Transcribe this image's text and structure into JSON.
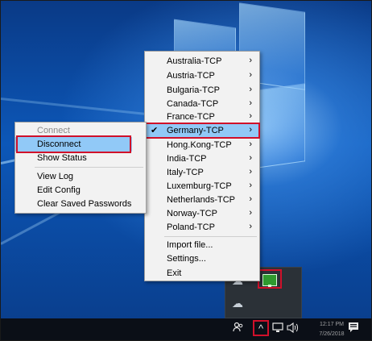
{
  "servers_menu": {
    "items": [
      {
        "label": "Australia-TCP",
        "arrow": "›"
      },
      {
        "label": "Austria-TCP",
        "arrow": "›"
      },
      {
        "label": "Bulgaria-TCP",
        "arrow": "›"
      },
      {
        "label": "Canada-TCP",
        "arrow": "›"
      },
      {
        "label": "France-TCP",
        "arrow": "›"
      },
      {
        "label": "Germany-TCP",
        "arrow": "›",
        "checked": "✔"
      },
      {
        "label": "Hong.Kong-TCP",
        "arrow": "›"
      },
      {
        "label": "India-TCP",
        "arrow": "›"
      },
      {
        "label": "Italy-TCP",
        "arrow": "›"
      },
      {
        "label": "Luxemburg-TCP",
        "arrow": "›"
      },
      {
        "label": "Netherlands-TCP",
        "arrow": "›"
      },
      {
        "label": "Norway-TCP",
        "arrow": "›"
      },
      {
        "label": "Poland-TCP",
        "arrow": "›"
      }
    ],
    "footer": [
      {
        "label": "Import file..."
      },
      {
        "label": "Settings..."
      },
      {
        "label": "Exit"
      }
    ]
  },
  "connection_menu": {
    "items": [
      {
        "label": "Connect",
        "state": "disabled"
      },
      {
        "label": "Disconnect"
      },
      {
        "label": "Show Status"
      },
      {
        "label": "View Log"
      },
      {
        "label": "Edit Config"
      },
      {
        "label": "Clear Saved Passwords"
      }
    ]
  },
  "taskbar": {
    "people_icon": "people-icon",
    "show_hidden_icons": "^",
    "network_icon": "network-icon",
    "volume_icon": "volume-icon",
    "notifications_icon": "notifications-icon",
    "clock_time": "12:17 PM",
    "clock_date": "7/26/2018"
  },
  "tray_flyout": {
    "icons": [
      "openvpn-connected-icon",
      "cloud-icon",
      "onedrive-icon"
    ]
  },
  "colors": {
    "highlight": "#91c9f7",
    "annotation": "#d0102a",
    "taskbar": "#0b0f17"
  }
}
